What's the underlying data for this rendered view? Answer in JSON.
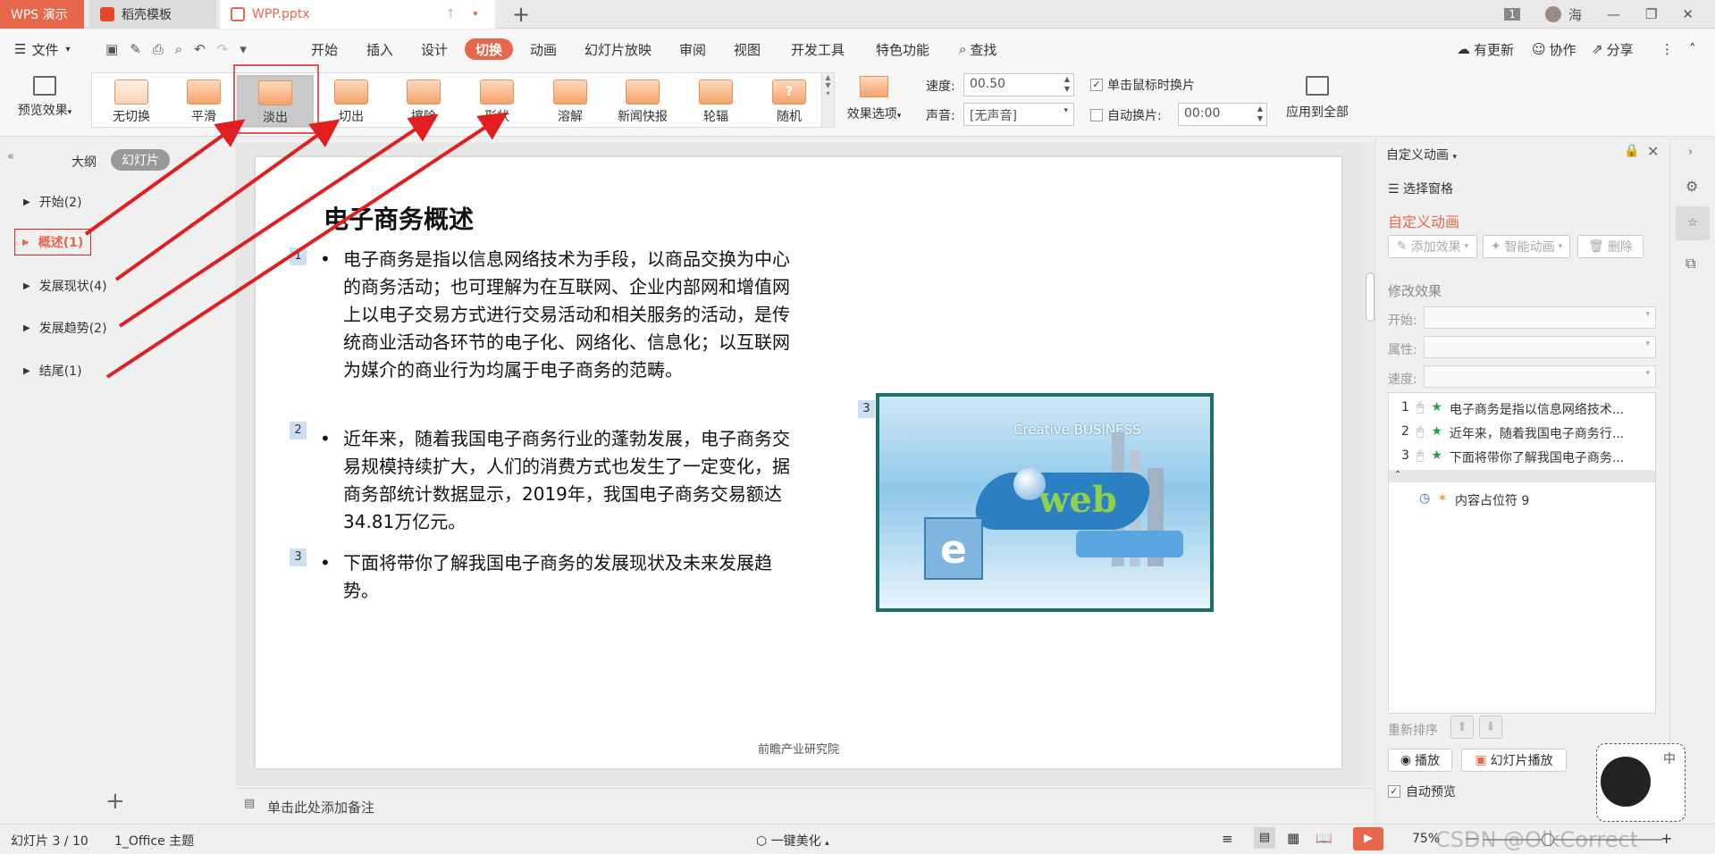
{
  "tabs": {
    "app": "WPS 演示",
    "doc1": "稻壳模板",
    "doc2": "WPP.pptx"
  },
  "window": {
    "badge": "1",
    "user": "海"
  },
  "menu": {
    "file": "文件",
    "items": [
      "开始",
      "插入",
      "设计",
      "切换",
      "动画",
      "幻灯片放映",
      "审阅",
      "视图",
      "开发工具",
      "特色功能"
    ],
    "active": "切换",
    "search": "查找",
    "update": "有更新",
    "collab": "协作",
    "share": "分享"
  },
  "ribbon": {
    "preview": "预览效果",
    "transitions": [
      "无切换",
      "平滑",
      "淡出",
      "切出",
      "擦除",
      "形状",
      "溶解",
      "新闻快报",
      "轮辐",
      "随机"
    ],
    "selected": "淡出",
    "effect_options": "效果选项",
    "speed_label": "速度:",
    "speed_value": "00.50",
    "sound_label": "声音:",
    "sound_value": "[无声音]",
    "on_click": "单击鼠标时换片",
    "auto": "自动换片:",
    "auto_value": "00:00",
    "apply_all": "应用到全部"
  },
  "outline": {
    "tab_outline": "大纲",
    "tab_slides": "幻灯片",
    "items": [
      {
        "label": "开始(2)"
      },
      {
        "label": "概述(1)"
      },
      {
        "label": "发展现状(4)"
      },
      {
        "label": "发展趋势(2)"
      },
      {
        "label": "结尾(1)"
      }
    ],
    "add": "+"
  },
  "slide": {
    "title": "电子商务概述",
    "paragraphs": [
      {
        "num": "1",
        "text": "电子商务是指以信息网络技术为手段，以商品交换为中心的商务活动；也可理解为在互联网、企业内部网和增值网上以电子交易方式进行交易活动和相关服务的活动，是传统商业活动各环节的电子化、网络化、信息化；以互联网为媒介的商业行为均属于电子商务的范畴。"
      },
      {
        "num": "2",
        "text": "近年来，随着我国电子商务行业的蓬勃发展，电子商务交易规模持续扩大，人们的消费方式也发生了一定变化，据商务部统计数据显示，2019年，我国电子商务交易额达34.81万亿元。"
      },
      {
        "num": "3",
        "text": "下面将带你了解我国电子商务的发展现状及未来发展趋势。"
      }
    ],
    "image_num": "3",
    "image_text1": "Creative BUSINESS",
    "image_text2": "web",
    "image_text3": "e",
    "footer": "前瞻产业研究院"
  },
  "notes": "单击此处添加备注",
  "panel": {
    "title": "自定义动画",
    "selection_pane": "选择窗格",
    "custom_anim": "自定义动画",
    "add_effect": "添加效果",
    "smart_anim": "智能动画",
    "delete": "删除",
    "modify": "修改效果",
    "start": "开始:",
    "prop": "属性:",
    "speed": "速度:",
    "rows": [
      {
        "n": "1",
        "t": "电子商务是指以信息网络技术..."
      },
      {
        "n": "2",
        "t": "近年来，随着我国电子商务行..."
      },
      {
        "n": "3",
        "t": "下面将带你了解我国电子商务..."
      }
    ],
    "sub": "内容占位符 9",
    "reorder": "重新排序",
    "play": "播放",
    "slideshow": "幻灯片播放",
    "autopreview": "自动预览"
  },
  "status": {
    "slide": "幻灯片 3 / 10",
    "theme": "1_Office 主题",
    "beautify": "一键美化",
    "zoom": "75%",
    "watermark": "CSDN @OlkCorrect",
    "ime": "中"
  },
  "colors": {
    "accent": "#e8674c",
    "arrow": "#e02020"
  }
}
